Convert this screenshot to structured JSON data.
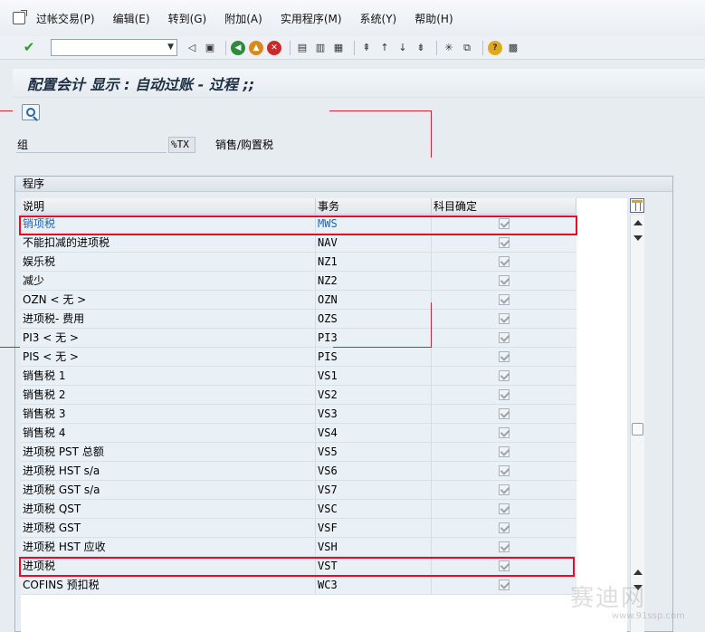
{
  "menu": {
    "items": [
      "过帐交易(P)",
      "编辑(E)",
      "转到(G)",
      "附加(A)",
      "实用程序(M)",
      "系统(Y)",
      "帮助(H)"
    ]
  },
  "toolbar": {
    "command_value": ""
  },
  "title": "配置会计 显示 : 自动过账 - 过程 ;;",
  "group": {
    "label": "组",
    "value": "%TX",
    "description": "销售/购置税"
  },
  "panel": {
    "title": "程序",
    "headers": [
      "说明",
      "事务",
      "科目确定"
    ],
    "rows": [
      {
        "desc": "销项税",
        "code": "MWS",
        "link": true
      },
      {
        "desc": "不能扣减的进项税",
        "code": "NAV"
      },
      {
        "desc": "娱乐税",
        "code": "NZ1"
      },
      {
        "desc": "减少",
        "code": "NZ2"
      },
      {
        "desc": "OZN < 无 >",
        "code": "OZN"
      },
      {
        "desc": "进项税- 费用",
        "code": "OZS"
      },
      {
        "desc": "PI3 < 无 >",
        "code": "PI3"
      },
      {
        "desc": "PIS < 无 >",
        "code": "PIS"
      },
      {
        "desc": "销售税 1",
        "code": "VS1"
      },
      {
        "desc": "销售税 2",
        "code": "VS2"
      },
      {
        "desc": "销售税 3",
        "code": "VS3"
      },
      {
        "desc": "销售税 4",
        "code": "VS4"
      },
      {
        "desc": "进项税 PST 总额",
        "code": "VS5"
      },
      {
        "desc": "进项税 HST s/a",
        "code": "VS6"
      },
      {
        "desc": "进项税 GST s/a",
        "code": "VS7"
      },
      {
        "desc": "进项税 QST",
        "code": "VSC"
      },
      {
        "desc": "进项税 GST",
        "code": "VSF"
      },
      {
        "desc": "进项税 HST 应收",
        "code": "VSH"
      },
      {
        "desc": "进项税",
        "code": "VST"
      },
      {
        "desc": "COFINS 预扣税",
        "code": "WC3"
      }
    ]
  },
  "watermark": {
    "text": "赛迪网",
    "url": "www.91ssp.com"
  },
  "colors": {
    "highlight": "#e0102a",
    "link": "#1f66b3",
    "row_bg": "#e9f0f6"
  }
}
